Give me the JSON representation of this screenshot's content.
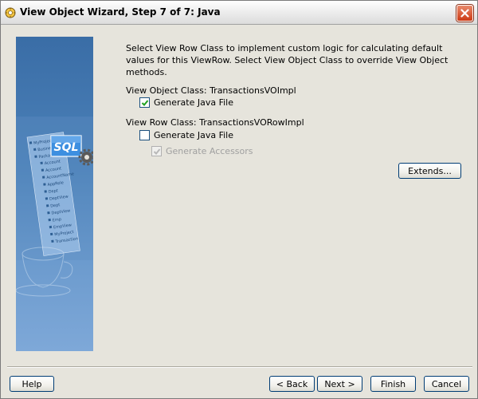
{
  "window": {
    "title": "View Object Wizard, Step 7 of 7: Java"
  },
  "banner": {
    "sql_text": "SQL",
    "tree_items": [
      "MyProject",
      "Business",
      "Package",
      "Account",
      "Account",
      "AccountName",
      "AppRole",
      "Dept",
      "DeptView",
      "Dept",
      "DeptView",
      "Emp",
      "EmpView",
      "MyProject",
      "Transaction"
    ]
  },
  "content": {
    "description": "Select View Row Class to implement custom logic for calculating default values for this ViewRow.  Select View Object Class to override View Object methods.",
    "view_object_class": {
      "label": "View Object Class: TransactionsVOImpl",
      "generate_java": {
        "label": "Generate Java File",
        "checked": true
      }
    },
    "view_row_class": {
      "label": "View Row Class: TransactionsVORowImpl",
      "generate_java": {
        "label": "Generate Java File",
        "checked": false
      },
      "generate_accessors": {
        "label": "Generate Accessors",
        "checked": true,
        "disabled": true
      }
    },
    "extends_button": "Extends..."
  },
  "footer": {
    "help": "Help",
    "back": "< Back",
    "next": "Next >",
    "finish": "Finish",
    "cancel": "Cancel"
  }
}
